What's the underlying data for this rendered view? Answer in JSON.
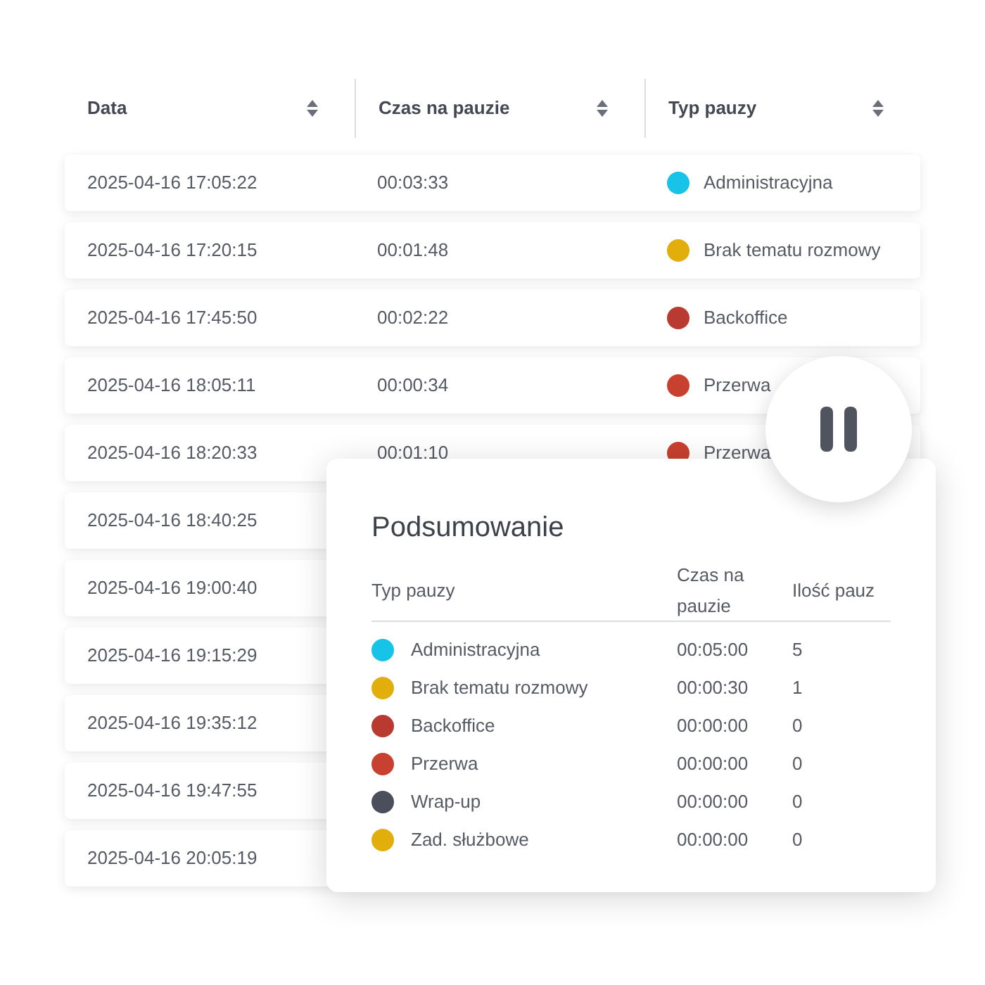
{
  "table": {
    "columns": [
      "Data",
      "Czas na pauzie",
      "Typ pauzy"
    ],
    "rows": [
      {
        "date": "2025-04-16 17:05:22",
        "duration": "00:03:33",
        "type": "Administracyjna",
        "color": "#17c3e6"
      },
      {
        "date": "2025-04-16 17:20:15",
        "duration": "00:01:48",
        "type": "Brak tematu rozmowy",
        "color": "#e2ae0b"
      },
      {
        "date": "2025-04-16 17:45:50",
        "duration": "00:02:22",
        "type": "Backoffice",
        "color": "#b83a30"
      },
      {
        "date": "2025-04-16 18:05:11",
        "duration": "00:00:34",
        "type": "Przerwa",
        "color": "#c8402f"
      },
      {
        "date": "2025-04-16 18:20:33",
        "duration": "00:01:10",
        "type": "Przerwa",
        "color": "#c8402f"
      },
      {
        "date": "2025-04-16 18:40:25"
      },
      {
        "date": "2025-04-16 19:00:40"
      },
      {
        "date": "2025-04-16 19:15:29"
      },
      {
        "date": "2025-04-16 19:35:12"
      },
      {
        "date": "2025-04-16 19:47:55"
      },
      {
        "date": "2025-04-16 20:05:19"
      }
    ]
  },
  "summary": {
    "title": "Podsumowanie",
    "columns": [
      "Typ pauzy",
      "Czas na pauzie",
      "Ilość pauz"
    ],
    "rows": [
      {
        "type": "Administracyjna",
        "duration": "00:05:00",
        "count": "5",
        "color": "#17c3e6"
      },
      {
        "type": "Brak tematu rozmowy",
        "duration": "00:00:30",
        "count": "1",
        "color": "#e2ae0b"
      },
      {
        "type": "Backoffice",
        "duration": "00:00:00",
        "count": "0",
        "color": "#b83a30"
      },
      {
        "type": "Przerwa",
        "duration": "00:00:00",
        "count": "0",
        "color": "#c8402f"
      },
      {
        "type": "Wrap-up",
        "duration": "00:00:00",
        "count": "0",
        "color": "#4b4f5c"
      },
      {
        "type": "Zad. służbowe",
        "duration": "00:00:00",
        "count": "0",
        "color": "#e2ae0b"
      }
    ]
  }
}
